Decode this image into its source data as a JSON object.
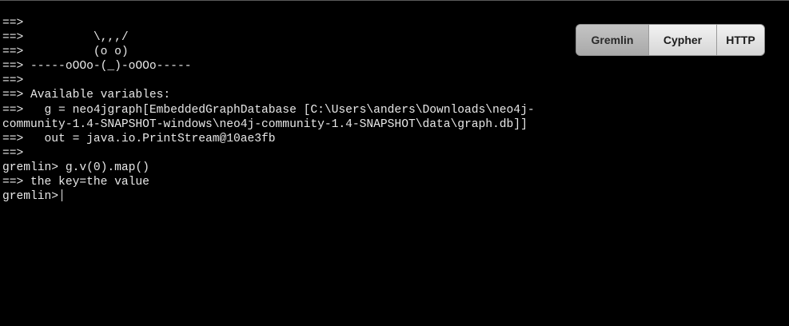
{
  "console": {
    "lines": [
      "==>",
      "==>          \\,,,/",
      "==>          (o o)",
      "==> -----oOOo-(_)-oOOo-----",
      "==>",
      "==> Available variables:",
      "==>   g = neo4jgraph[EmbeddedGraphDatabase [C:\\Users\\anders\\Downloads\\neo4j-",
      "community-1.4-SNAPSHOT-windows\\neo4j-community-1.4-SNAPSHOT\\data\\graph.db]]",
      "==>   out = java.io.PrintStream@10ae3fb",
      "==>",
      "gremlin> g.v(0).map()",
      "==> the key=the value"
    ],
    "prompt": "gremlin>"
  },
  "mode_switch": {
    "tabs": [
      {
        "label": "Gremlin",
        "active": true
      },
      {
        "label": "Cypher",
        "active": false
      },
      {
        "label": "HTTP",
        "active": false
      }
    ]
  },
  "colors": {
    "background": "#000000",
    "text": "#e8e8e8",
    "active_tab": "#b5b5b5",
    "inactive_tab": "#e6e6e6"
  }
}
